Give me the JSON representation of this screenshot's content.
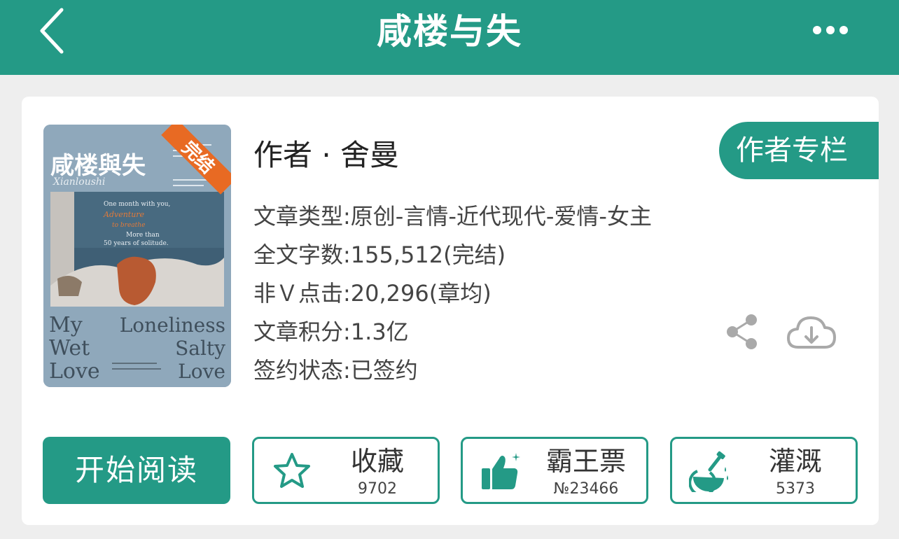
{
  "header": {
    "title": "咸楼与失"
  },
  "book": {
    "author": "作者 · 舍曼",
    "author_column_label": "作者专栏",
    "info": [
      "文章类型:原创-言情-近代现代-爱情-女主",
      "全文字数:155,512(完结)",
      "非Ｖ点击:20,296(章均)",
      "文章积分:1.3亿",
      "签约状态:已签约"
    ],
    "cover": {
      "title": "咸楼與失",
      "pinyin": "Xianloushi",
      "ribbon": "完结",
      "caption_lines": [
        "One month with you,",
        "Adventure",
        "to breathe",
        "More than",
        "50 years of solitude."
      ],
      "left_words": [
        "My",
        "Wet",
        "Love"
      ],
      "right_words": [
        "Loneliness",
        "Salty",
        "Love"
      ]
    }
  },
  "actions": {
    "read_label": "开始阅读",
    "favorite": {
      "label": "收藏",
      "count": "9702"
    },
    "vote": {
      "label": "霸王票",
      "count": "№23466"
    },
    "water": {
      "label": "灌溉",
      "count": "5373"
    }
  },
  "colors": {
    "primary": "#249a86",
    "ribbon": "#e86a23",
    "icon_gray": "#a9a9a9"
  }
}
